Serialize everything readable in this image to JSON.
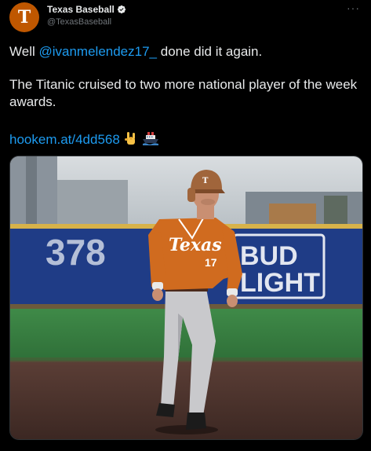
{
  "tweet": {
    "display_name": "Texas Baseball",
    "handle": "@TexasBaseball",
    "avatar_letter": "T",
    "verified": true,
    "more_icon": "more-icon",
    "text_prefix": "Well ",
    "mention": "@ivanmelendez17_",
    "text_suffix": " done did it again.",
    "paragraph2": "The Titanic cruised to two more national player of the week awards.",
    "link": "hookem.at/4dd568",
    "emojis": [
      "horns-emoji",
      "ship-emoji"
    ],
    "photo": {
      "description_icon": "baseball-player-photo",
      "jersey_text": "Texas",
      "jersey_number": "17",
      "outfield_sign": "378",
      "ad_sign_line1": "BUD",
      "ad_sign_line2": "LIGHT"
    }
  },
  "colors": {
    "background": "#000000",
    "text": "#e7e9ea",
    "secondary": "#71767b",
    "link": "#1d9bf0",
    "brand": "#bf5700"
  }
}
